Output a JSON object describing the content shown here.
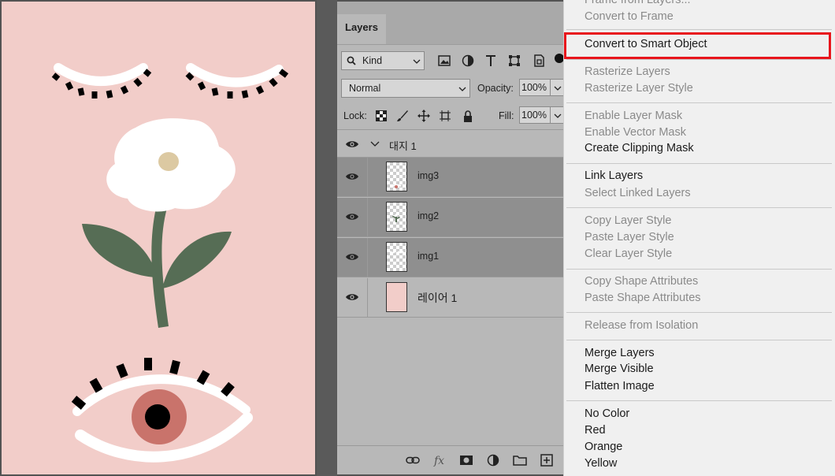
{
  "panel": {
    "tab_label": "Layers",
    "filter_kind": "Kind",
    "blend_mode": "Normal",
    "opacity_label": "Opacity:",
    "opacity_value": "100%",
    "lock_label": "Lock:",
    "fill_label": "Fill:",
    "fill_value": "100%",
    "group_name": "대지 1",
    "layers": [
      {
        "name": "img3",
        "selected": true
      },
      {
        "name": "img2",
        "selected": true
      },
      {
        "name": "img1",
        "selected": true
      },
      {
        "name": "레이어 1",
        "selected": false
      }
    ]
  },
  "menu": {
    "items": [
      {
        "label": "Frame from Layers...",
        "enabled": false
      },
      {
        "label": "Convert to Frame",
        "enabled": false
      },
      {
        "label": "Convert to Smart Object",
        "enabled": true,
        "highlighted": true
      },
      {
        "label": "Rasterize Layers",
        "enabled": false
      },
      {
        "label": "Rasterize Layer Style",
        "enabled": false
      },
      {
        "label": "Enable Layer Mask",
        "enabled": false
      },
      {
        "label": "Enable Vector Mask",
        "enabled": false
      },
      {
        "label": "Create Clipping Mask",
        "enabled": true
      },
      {
        "label": "Link Layers",
        "enabled": true
      },
      {
        "label": "Select Linked Layers",
        "enabled": false
      },
      {
        "label": "Copy Layer Style",
        "enabled": false
      },
      {
        "label": "Paste Layer Style",
        "enabled": false
      },
      {
        "label": "Clear Layer Style",
        "enabled": false
      },
      {
        "label": "Copy Shape Attributes",
        "enabled": false
      },
      {
        "label": "Paste Shape Attributes",
        "enabled": false
      },
      {
        "label": "Release from Isolation",
        "enabled": false
      },
      {
        "label": "Merge Layers",
        "enabled": true
      },
      {
        "label": "Merge Visible",
        "enabled": true
      },
      {
        "label": "Flatten Image",
        "enabled": true
      },
      {
        "label": "No Color",
        "enabled": true
      },
      {
        "label": "Red",
        "enabled": true
      },
      {
        "label": "Orange",
        "enabled": true
      },
      {
        "label": "Yellow",
        "enabled": true
      }
    ]
  },
  "colors": {
    "artboard_bg": "#f2cdc9",
    "leaf_green": "#566d55",
    "flower_center": "#dcc9a2",
    "iris": "#c9736b",
    "highlight_border": "#e8151c",
    "selected_layer_bg": "#8f8f8f",
    "panel_bg": "#b8b8b8"
  }
}
